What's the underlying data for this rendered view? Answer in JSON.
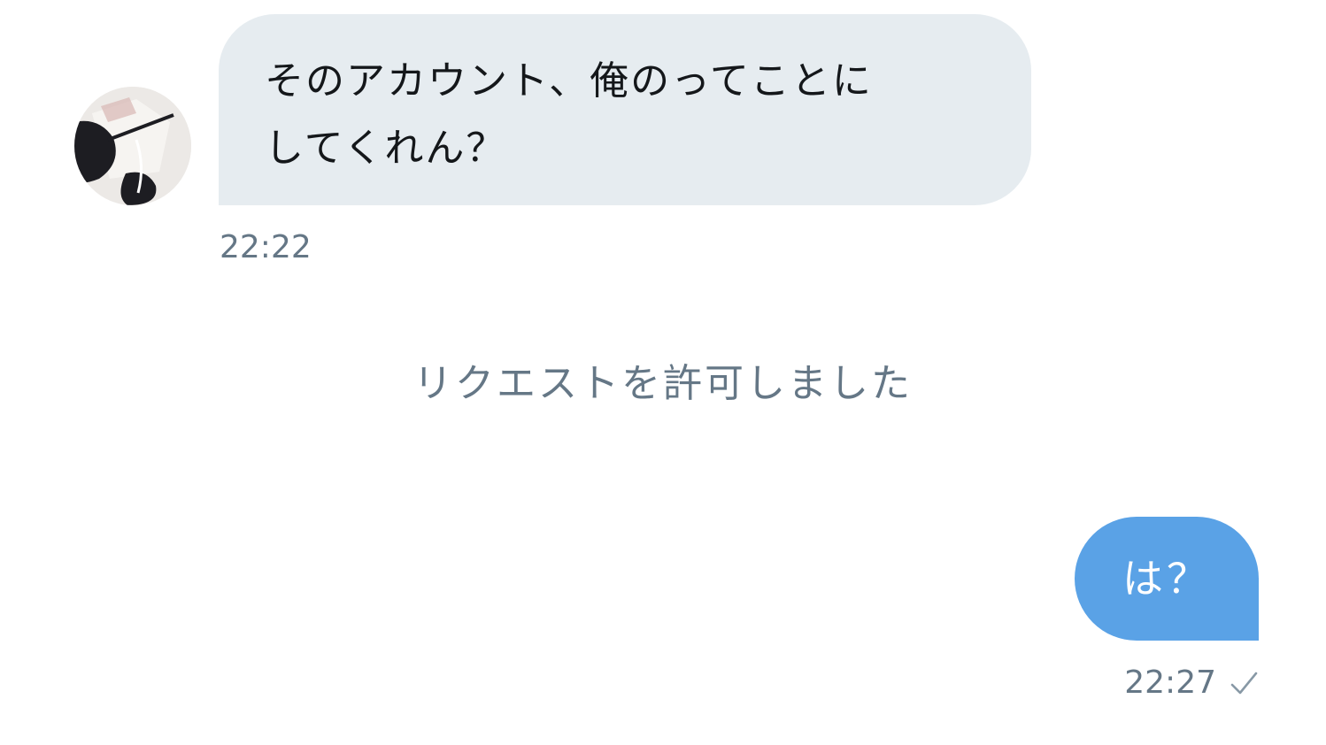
{
  "conversation": {
    "incoming": {
      "text": "そのアカウント、俺のってことに\nしてくれん？",
      "timestamp": "22:22",
      "avatar_icon": "user-avatar-photo"
    },
    "system_note": "リクエストを許可しました",
    "outgoing": {
      "text": "は？",
      "timestamp": "22:27",
      "status_icon": "check-icon"
    }
  },
  "colors": {
    "incoming_bubble": "#e6ecf0",
    "outgoing_bubble": "#5aa2e6",
    "meta_text": "#657786",
    "primary_text": "#14171a"
  }
}
